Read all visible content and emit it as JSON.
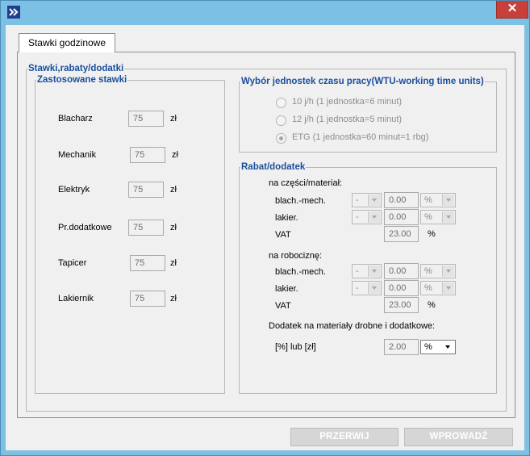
{
  "window": {
    "close_glyph": "✕",
    "app_icon": "double-chevron-icon"
  },
  "tab": {
    "label": "Stawki godzinowe"
  },
  "groups": {
    "outer": "Stawki,rabaty/dodatki",
    "rates": "Zastosowane stawki",
    "wtu": "Wybór jednostek czasu pracy(WTU-working time units)",
    "discount": "Rabat/dodatek"
  },
  "rates": [
    {
      "label": "Blacharz",
      "value": "75",
      "unit": "zł"
    },
    {
      "label": "Mechanik",
      "value": "75",
      "unit": "zł"
    },
    {
      "label": "Elektryk",
      "value": "75",
      "unit": "zł"
    },
    {
      "label": "Pr.dodatkowe",
      "value": "75",
      "unit": "zł"
    },
    {
      "label": "Tapicer",
      "value": "75",
      "unit": "zł"
    },
    {
      "label": "Lakiernik",
      "value": "75",
      "unit": "zł"
    }
  ],
  "wtu_options": [
    {
      "label": "10 j/h (1 jednostka=6 minut)",
      "checked": false
    },
    {
      "label": "12 j/h (1 jednostka=5 minut)",
      "checked": false
    },
    {
      "label": "ETG   (1 jednostka=60 minut=1 rbg)",
      "checked": true
    }
  ],
  "parts": {
    "title": "na części/materiał:",
    "rows": [
      {
        "label": "blach.-mech.",
        "sign": "-",
        "value": "0.00",
        "unit": "%"
      },
      {
        "label": "lakier.",
        "sign": "-",
        "value": "0.00",
        "unit": "%"
      }
    ],
    "vat_label": "VAT",
    "vat_value": "23.00",
    "vat_unit": "%"
  },
  "labor": {
    "title": "na robociznę:",
    "rows": [
      {
        "label": "blach.-mech.",
        "sign": "-",
        "value": "0.00",
        "unit": "%"
      },
      {
        "label": "lakier.",
        "sign": "-",
        "value": "0.00",
        "unit": "%"
      }
    ],
    "vat_label": "VAT",
    "vat_value": "23.00",
    "vat_unit": "%"
  },
  "extra": {
    "title": "Dodatek na materiały drobne i dodatkowe:",
    "label": "[%] lub [zł]",
    "value": "2.00",
    "unit": "%"
  },
  "buttons": {
    "cancel": "PRZERWIJ",
    "submit": "WPROWADŹ"
  }
}
